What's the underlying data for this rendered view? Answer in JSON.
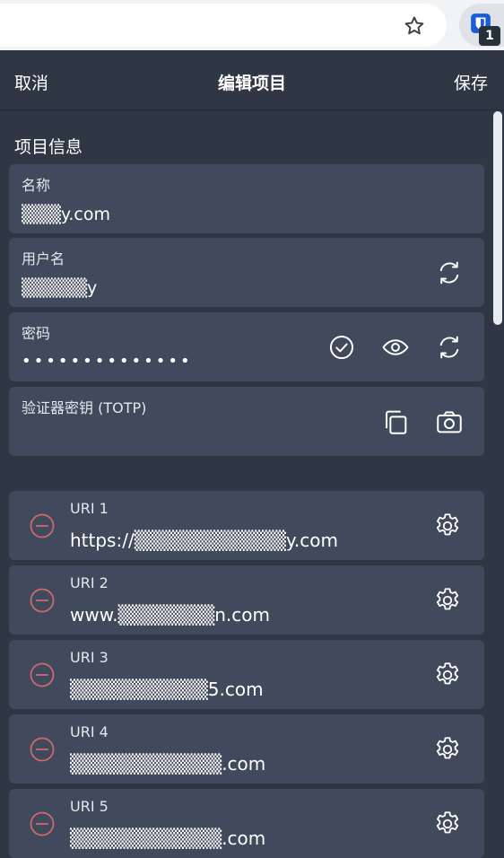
{
  "header": {
    "cancel_label": "取消",
    "title": "编辑项目",
    "save_label": "保存"
  },
  "extension": {
    "badge_count": "1"
  },
  "item_info": {
    "section_title": "项目信息",
    "name": {
      "label": "名称",
      "value": "▒▒▒y.com"
    },
    "username": {
      "label": "用户名",
      "value": "▒▒▒▒▒y"
    },
    "password": {
      "label": "密码",
      "value": "••••••••••••••"
    },
    "totp": {
      "label": "验证器密钥 (TOTP)",
      "value": ""
    }
  },
  "uris": [
    {
      "label": "URI 1",
      "value": "https://▒▒▒▒▒▒▒▒▒▒▒y.com"
    },
    {
      "label": "URI 2",
      "value": "www.▒▒▒▒▒▒▒n.com"
    },
    {
      "label": "URI 3",
      "value": "▒▒▒▒▒▒▒▒▒▒5.com"
    },
    {
      "label": "URI 4",
      "value": "▒▒▒▒▒▒▒▒▒▒▒.com"
    },
    {
      "label": "URI 5",
      "value": "▒▒▒▒▒▒▒▒▒▒▒.com"
    }
  ],
  "colors": {
    "panel_bg": "#2f3644",
    "field_bg": "#414a5c",
    "remove_icon": "#d06a6a",
    "text": "#ffffff"
  },
  "icons": {
    "refresh": "refresh-icon",
    "check": "check-circle-icon",
    "eye": "eye-icon",
    "copy": "copy-icon",
    "camera": "camera-icon",
    "remove": "remove-circle-icon",
    "gear": "gear-icon"
  }
}
